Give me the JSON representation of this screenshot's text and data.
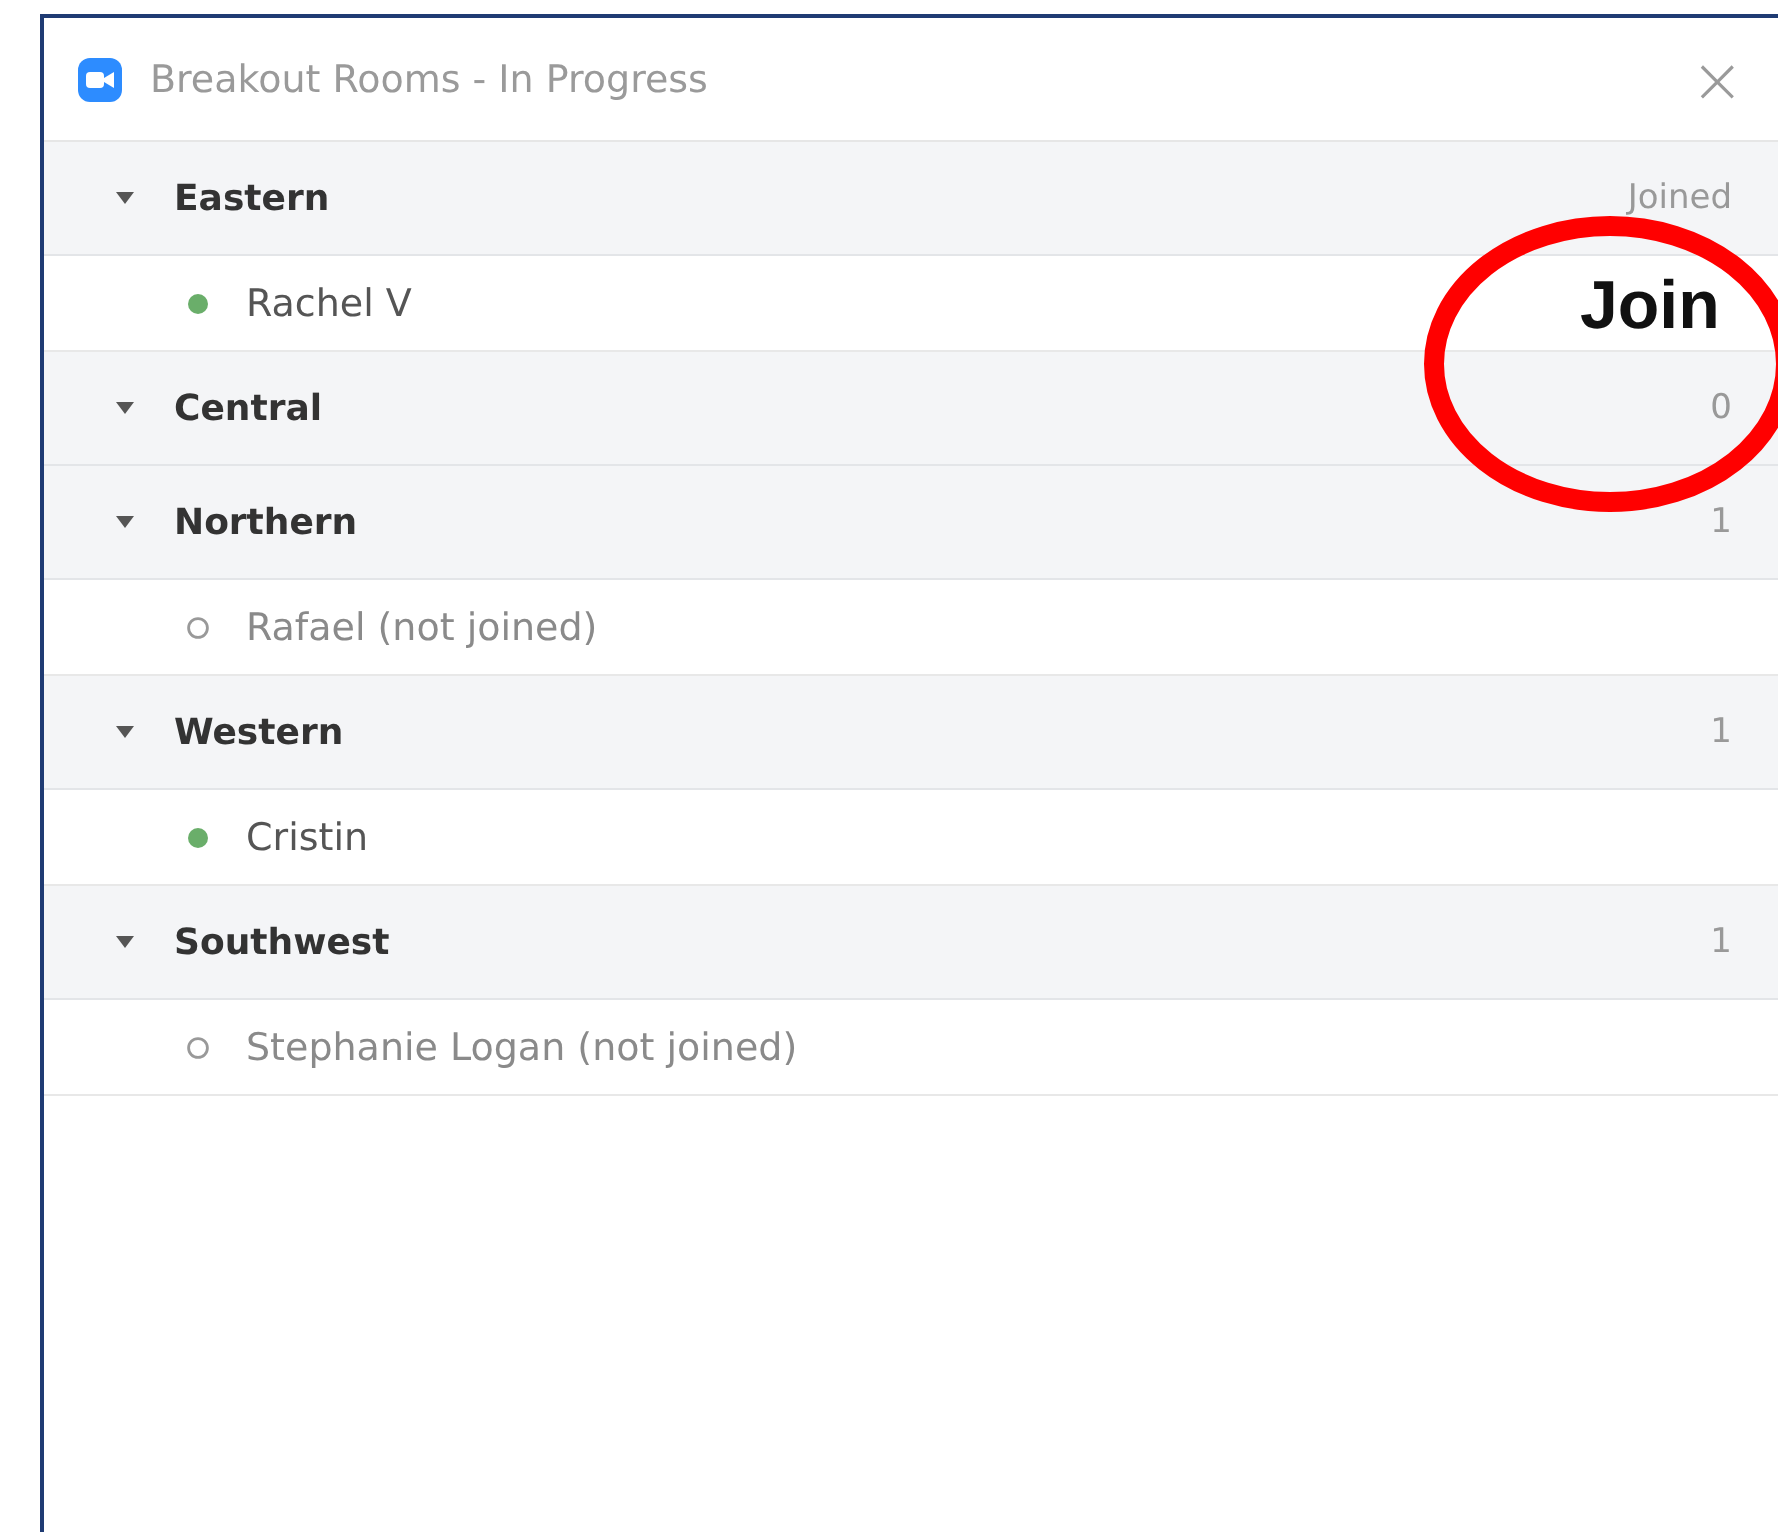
{
  "window": {
    "title": "Breakout Rooms - In Progress",
    "close": "×"
  },
  "rooms": [
    {
      "name": "Eastern",
      "expanded": true,
      "count": "Joined",
      "members": [
        {
          "name": "Rachel V",
          "joined": true
        }
      ]
    },
    {
      "name": "Central",
      "expanded": true,
      "count": "0"
    },
    {
      "name": "Northern",
      "expanded": true,
      "count": "1",
      "members": [
        {
          "name": "Rafael (not joined)",
          "joined": false
        }
      ]
    },
    {
      "name": "Western",
      "expanded": true,
      "count": "1",
      "members": [
        {
          "name": "Cristin",
          "joined": true
        }
      ]
    },
    {
      "name": "Southwest",
      "expanded": true,
      "count": "1",
      "members": [
        {
          "name": "Stephanie Logan (not joined)",
          "joined": false
        }
      ]
    }
  ],
  "annotation": {
    "label": "Join"
  }
}
